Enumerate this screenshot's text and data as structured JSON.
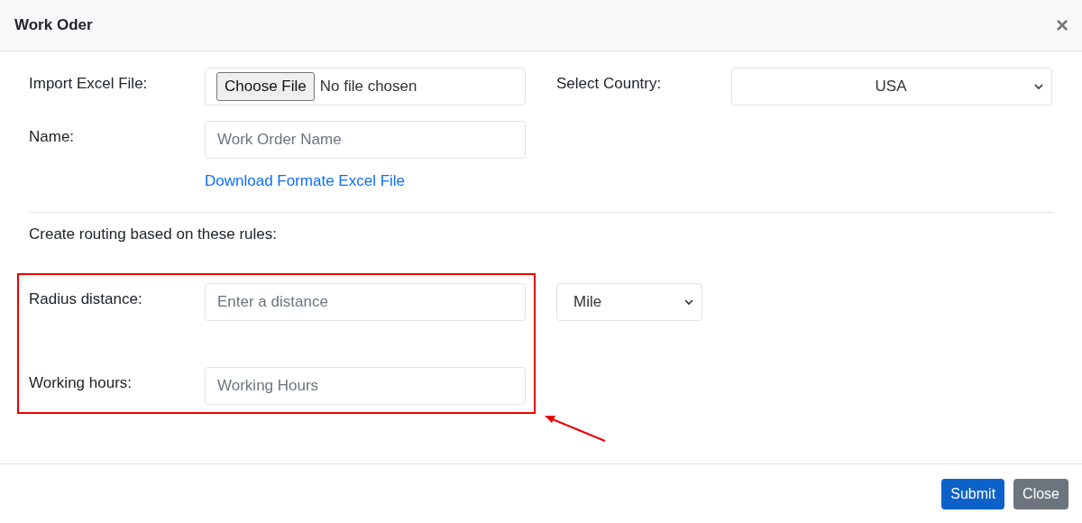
{
  "dialog": {
    "title": "Work Oder",
    "close": "×"
  },
  "import": {
    "label": "Import Excel File:",
    "button": "Choose File",
    "status": "No file chosen"
  },
  "country": {
    "label": "Select Country:",
    "value": "USA"
  },
  "name": {
    "label": "Name:",
    "placeholder": "Work Order Name"
  },
  "download_link": "Download Formate Excel File",
  "rules_heading": "Create routing based on these rules:",
  "radius": {
    "label": "Radius distance:",
    "placeholder": "Enter a distance",
    "unit": "Mile"
  },
  "hours": {
    "label": "Working hours:",
    "placeholder": "Working Hours"
  },
  "buttons": [
    {
      "label": "Submit",
      "kind": "primary"
    },
    {
      "label": "Close",
      "kind": "secondary"
    }
  ]
}
